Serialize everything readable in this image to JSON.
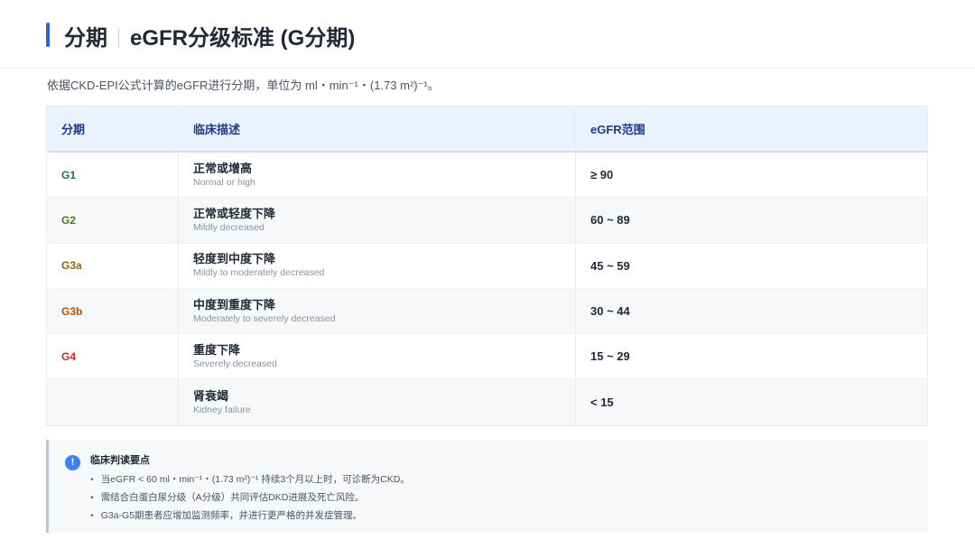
{
  "header": {
    "title_left": "分期",
    "title_right": "eGFR分级标准 (G分期)",
    "accent_color": "#2563eb"
  },
  "intro": "依据CKD-EPI公式计算的eGFR进行分期，单位为 ml・min⁻¹・(1.73 m²)⁻¹。",
  "table": {
    "headers": [
      "分期",
      "临床描述",
      "eGFR范围"
    ],
    "rows": [
      {
        "stage": "G1",
        "stage_color": "#15803d",
        "desc_cn": "正常或增高",
        "desc_en": "Normal or high",
        "range": "≥ 90"
      },
      {
        "stage": "G2",
        "stage_color": "#4d7c0f",
        "desc_cn": "正常或轻度下降",
        "desc_en": "Mildly decreased",
        "range": "60 ~ 89"
      },
      {
        "stage": "G3a",
        "stage_color": "#a16207",
        "desc_cn": "轻度到中度下降",
        "desc_en": "Mildly to moderately decreased",
        "range": "45 ~ 59"
      },
      {
        "stage": "G3b",
        "stage_color": "#b45309",
        "desc_cn": "中度到重度下降",
        "desc_en": "Moderately to severely decreased",
        "range": "30 ~ 44"
      },
      {
        "stage": "G4",
        "stage_color": "#dc2626",
        "desc_cn": "重度下降",
        "desc_en": "Severely decreased",
        "range": "15 ~ 29"
      },
      {
        "stage": "",
        "stage_color": "#b91c1c",
        "desc_cn": "肾衰竭",
        "desc_en": "Kidney failure",
        "range": "< 15"
      }
    ]
  },
  "note": {
    "icon": "info-icon",
    "icon_glyph": "!",
    "title": "临床判读要点",
    "items": [
      "当eGFR < 60 ml・min⁻¹・(1.73 m²)⁻¹ 持续3个月以上时，可诊断为CKD。",
      "需结合白蛋白尿分级（A分级）共同评估DKD进展及死亡风险。",
      "G3a-G5期患者应增加监测频率，并进行更严格的并发症管理。"
    ]
  }
}
